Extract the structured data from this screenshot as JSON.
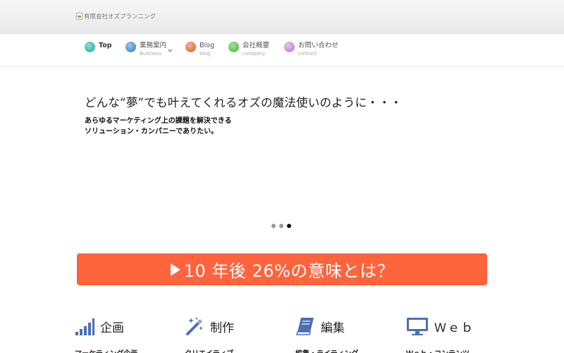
{
  "header": {
    "logo_alt": "有限会社オズプランニング"
  },
  "nav": {
    "items": [
      {
        "label": "Top",
        "sub": "",
        "color": "#3fb8a4"
      },
      {
        "label": "業務案内",
        "sub": "Business",
        "color": "#4a90d9"
      },
      {
        "label": "Blog",
        "sub": "blog",
        "color": "#e8704a"
      },
      {
        "label": "会社概要",
        "sub": "company",
        "color": "#5cbf4a"
      },
      {
        "label": "お問い合わせ",
        "sub": "contact",
        "color": "#c58ad6"
      }
    ]
  },
  "hero": {
    "title": "どんな“夢”でも叶えてくれるオズの魔法使いのように・・・",
    "sub_line1": "あらゆるマーケティング上の課題を解決できる",
    "sub_line2": "ソリューション・カンパニーでありたい。",
    "slides_total": 3,
    "active_slide": 3
  },
  "banner": {
    "text": "10 年後 26%の意味とは？",
    "color": "#ff643c"
  },
  "services": [
    {
      "title": "企画",
      "sub": "マーケティング企画",
      "icon": "bar-chart-icon"
    },
    {
      "title": "制作",
      "sub": "クリエイティブ",
      "icon": "magic-wand-icon"
    },
    {
      "title": "編集",
      "sub": "編集・ライティング",
      "icon": "book-icon"
    },
    {
      "title": "Ｗｅｂ",
      "sub": "Ｗｅｂ・コンテンツ",
      "icon": "monitor-icon"
    }
  ],
  "colors": {
    "accent_blue": "#4a6fb5",
    "banner": "#ff643c"
  }
}
